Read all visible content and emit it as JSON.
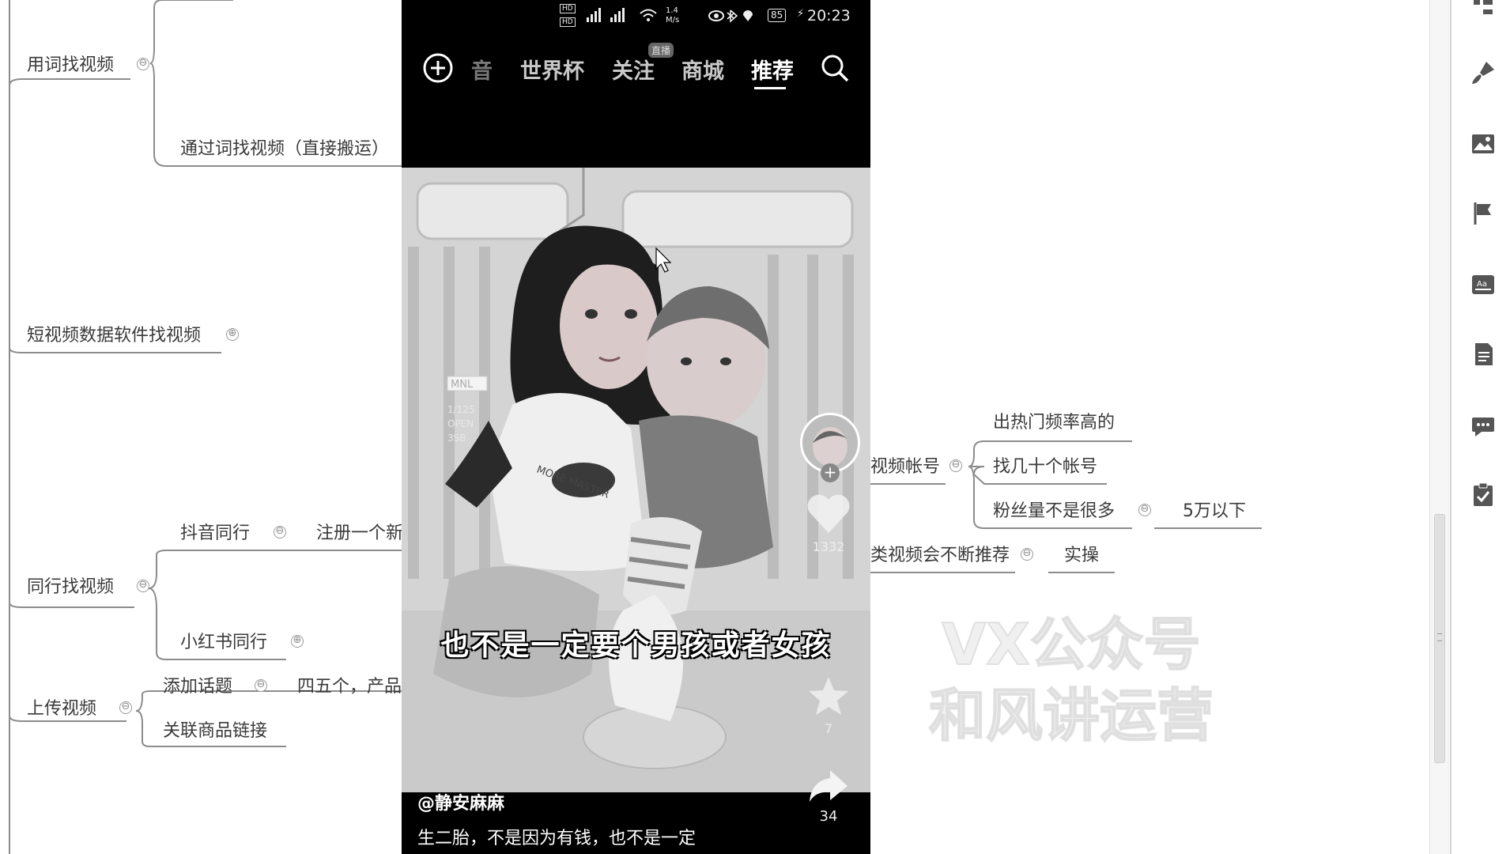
{
  "mindmap": {
    "find_by_keyword": "用词找视频",
    "via_keyword_repost": "通过词找视频（直接搬运）",
    "short_video_software": "短视频数据软件找视频",
    "peer_find": "同行找视频",
    "douyin_peer": "抖音同行",
    "register_new": "注册一个新",
    "xiaohongshu_peer": "小红书同行",
    "upload_video": "上传视频",
    "add_topic": "添加话题",
    "four_five": "四五个，产品",
    "link_product": "关联商品链接",
    "video_account": "视频帐号",
    "hot_frequency": "出热门频率高的",
    "find_ten_accounts": "找几十个帐号",
    "fans_not_many": "粉丝量不是很多",
    "under_50k": "5万以下",
    "keep_recommending": "类视频会不断推荐",
    "practice": "实操",
    "collapse_symbol": "⊖",
    "expand_symbol": "⊕"
  },
  "phone": {
    "status": {
      "hd1": "HD",
      "hd2": "HD",
      "net_speed": "1.4 M/s",
      "battery": "85",
      "time": "20:23"
    },
    "tabs": {
      "partial": "音",
      "worldcup": "世界杯",
      "follow": "关注",
      "live_badge": "直播",
      "mall": "商城",
      "recommend": "推荐"
    },
    "video": {
      "subtitle": "也不是一定要个男孩或者女孩",
      "label_mnl": "MNL",
      "label_1": "1/125",
      "label_2": "OPEN",
      "label_3": "3SB",
      "shirt_text": "MORE MASTER",
      "like_count": "1332",
      "share_count": "34",
      "collect_count": "7"
    },
    "author": "@静安麻麻",
    "caption": "生二胎，不是因为有钱，也不是一定"
  },
  "watermark": {
    "line1": "VX公众号",
    "line2": "和风讲运营"
  },
  "toolbar_icons": [
    "outline-icon",
    "brush-icon",
    "image-icon",
    "flag-icon",
    "text-style-icon",
    "note-icon",
    "comment-icon",
    "task-icon"
  ]
}
